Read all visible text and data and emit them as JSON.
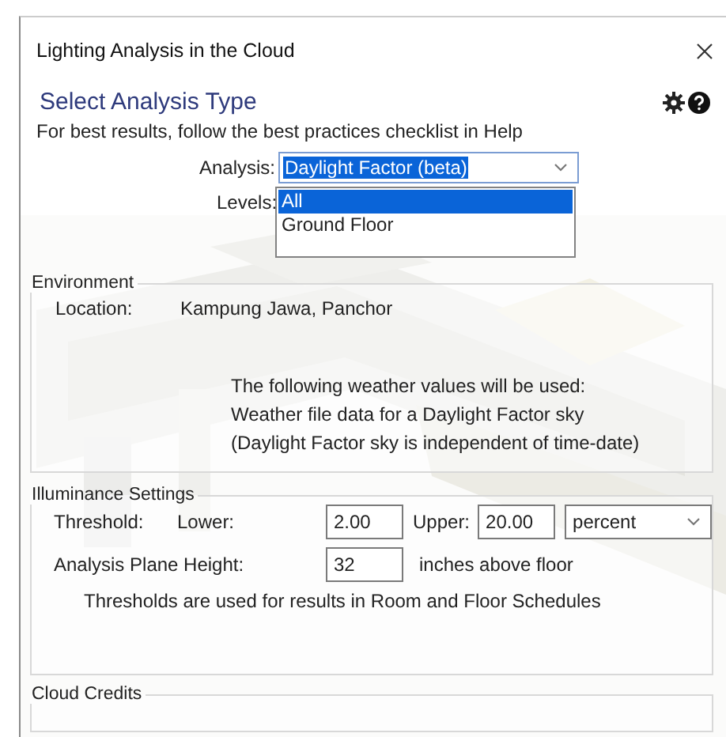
{
  "window": {
    "title": "Lighting Analysis in the Cloud"
  },
  "analysis_type": {
    "heading": "Select Analysis Type",
    "hint": "For best results, follow the best practices checklist in Help",
    "analysis": {
      "label": "Analysis:",
      "value": "Daylight Factor (beta)"
    },
    "levels": {
      "label": "Levels:",
      "items": [
        {
          "label": "All",
          "selected": true
        },
        {
          "label": "Ground Floor",
          "selected": false
        }
      ]
    }
  },
  "environment": {
    "title": "Environment",
    "location_label": "Location:",
    "location_value": "Kampung Jawa, Panchor",
    "weather_lines": [
      "The following weather values will be used:",
      "Weather file data for a Daylight Factor sky",
      "(Daylight Factor sky is independent of time-date)"
    ]
  },
  "illuminance": {
    "title": "Illuminance Settings",
    "threshold_label": "Threshold:",
    "lower_label": "Lower:",
    "lower_value": "2.00",
    "upper_label": "Upper:",
    "upper_value": "20.00",
    "unit_value": "percent",
    "plane_height_label": "Analysis Plane Height:",
    "plane_height_value": "32",
    "plane_height_unit": "inches above floor",
    "note": "Thresholds are used for results in Room and Floor Schedules"
  },
  "cloud_credits": {
    "title": "Cloud Credits"
  }
}
